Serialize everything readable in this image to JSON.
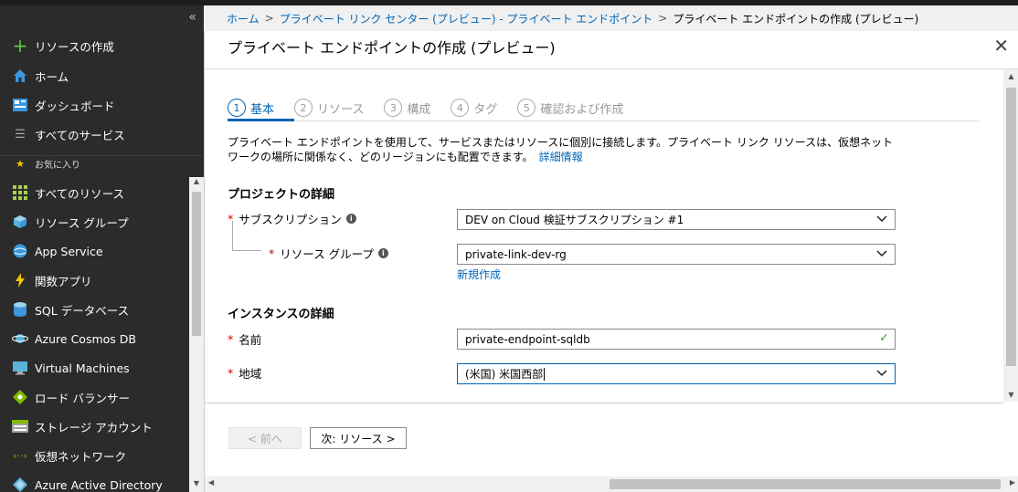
{
  "breadcrumb": {
    "items": [
      "ホーム",
      "プライベート リンク センター (プレビュー) - プライベート エンドポイント"
    ],
    "current": "プライベート エンドポイントの作成 (プレビュー)"
  },
  "sidebar": {
    "collapse_glyph": "«",
    "top_items": [
      {
        "label": "リソースの作成",
        "icon": "plus-icon"
      },
      {
        "label": "ホーム",
        "icon": "home-icon"
      },
      {
        "label": "ダッシュボード",
        "icon": "dashboard-icon"
      },
      {
        "label": "すべてのサービス",
        "icon": "list-icon"
      }
    ],
    "favorites_label": "お気に入り",
    "favorites": [
      {
        "label": "すべてのリソース",
        "icon": "grid-icon"
      },
      {
        "label": "リソース グループ",
        "icon": "cube-icon"
      },
      {
        "label": "App Service",
        "icon": "globe-icon"
      },
      {
        "label": "関数アプリ",
        "icon": "lightning-icon"
      },
      {
        "label": "SQL データベース",
        "icon": "sql-icon"
      },
      {
        "label": "Azure Cosmos DB",
        "icon": "planet-icon"
      },
      {
        "label": "Virtual Machines",
        "icon": "monitor-icon"
      },
      {
        "label": "ロード バランサー",
        "icon": "diamond-icon"
      },
      {
        "label": "ストレージ アカウント",
        "icon": "storage-icon"
      },
      {
        "label": "仮想ネットワーク",
        "icon": "network-icon"
      },
      {
        "label": "Azure Active Directory",
        "icon": "diamond-blue-icon"
      }
    ]
  },
  "panel": {
    "title": "プライベート エンドポイントの作成 (プレビュー)",
    "close_glyph": "✕",
    "steps": [
      {
        "num": "1",
        "label": "基本"
      },
      {
        "num": "2",
        "label": "リソース"
      },
      {
        "num": "3",
        "label": "構成"
      },
      {
        "num": "4",
        "label": "タグ"
      },
      {
        "num": "5",
        "label": "確認および作成"
      }
    ],
    "description": "プライベート エンドポイントを使用して、サービスまたはリソースに個別に接続します。プライベート リンク リソースは、仮想ネットワークの場所に関係なく、どのリージョンにも配置できます。",
    "learn_more": "詳細情報",
    "project_section": "プロジェクトの詳細",
    "subscription_label": "サブスクリプション",
    "subscription_value": "DEV on Cloud 検証サブスクリプション #1",
    "rg_label": "リソース グループ",
    "rg_value": "private-link-dev-rg",
    "new_link": "新規作成",
    "instance_section": "インスタンスの詳細",
    "name_label": "名前",
    "name_value": "private-endpoint-sqldb",
    "region_label": "地域",
    "region_value": "(米国) 米国西部",
    "required_mark": "*",
    "info_glyph": "i",
    "prev_button": "< 前へ",
    "next_button": "次: リソース >"
  }
}
